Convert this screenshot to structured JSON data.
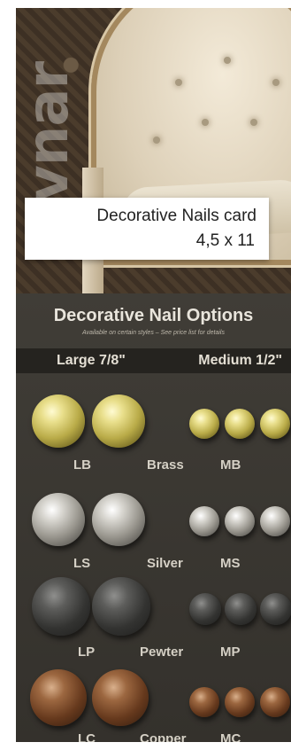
{
  "brand_text": "avnar",
  "label": {
    "line1": "Decorative Nails card",
    "line2": "4,5 x 11"
  },
  "panel": {
    "title": "Decorative Nail Options",
    "subtitle": "Available on certain styles – See price list for details",
    "sizes": {
      "large": "Large 7/8\"",
      "medium": "Medium 1/2\""
    }
  },
  "rows": [
    {
      "large_code": "LB",
      "finish": "Brass",
      "medium_code": "MB"
    },
    {
      "large_code": "LS",
      "finish": "Silver",
      "medium_code": "MS"
    },
    {
      "large_code": "LP",
      "finish": "Pewter",
      "medium_code": "MP"
    },
    {
      "large_code": "LC",
      "finish": "Copper",
      "medium_code": "MC"
    }
  ],
  "colors": {
    "panel_bg": "#3a3732",
    "size_bar": "#25231f",
    "label_bg": "#ffffff"
  }
}
